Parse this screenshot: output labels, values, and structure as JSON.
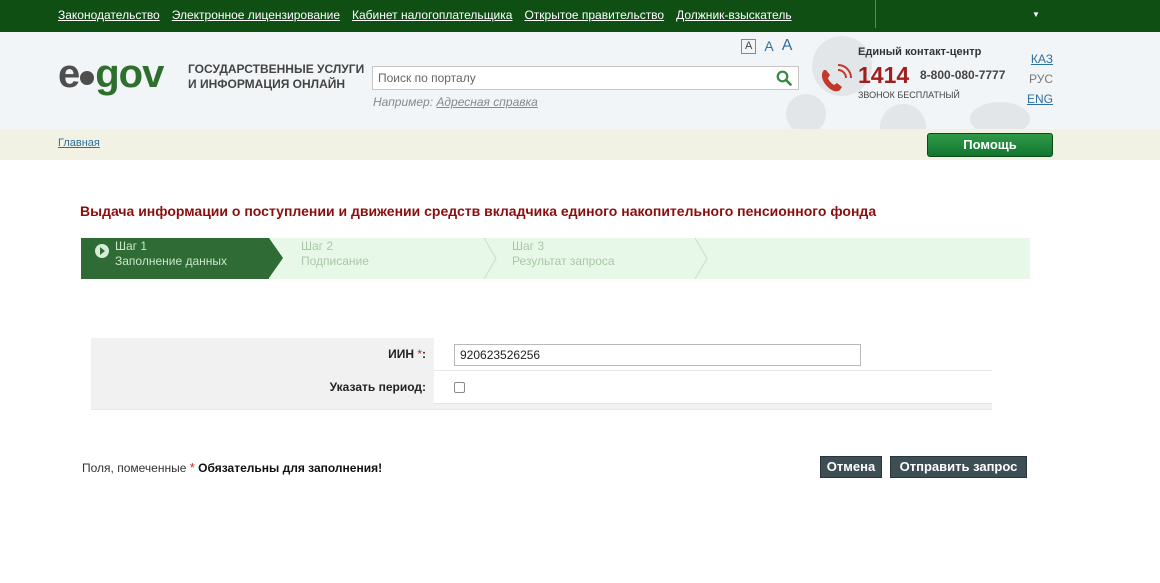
{
  "topnav": {
    "links": [
      "Законодательство",
      "Электронное лицензирование",
      "Кабинет налогоплательщика",
      "Открытое правительство",
      "Должник-взыскатель"
    ]
  },
  "header": {
    "logo": {
      "left": "e",
      "right": "gov"
    },
    "tagline": {
      "line1": "ГОСУДАРСТВЕННЫЕ УСЛУГИ",
      "line2": "И ИНФОРМАЦИЯ ОНЛАЙН"
    },
    "search": {
      "placeholder": "Поиск по порталу"
    },
    "example": {
      "prefix": "Например:",
      "link": "Адресная справка"
    },
    "font_sizes": [
      "A",
      "A",
      "A"
    ],
    "contact": {
      "title": "Единый контакт-центр",
      "short_number": "1414",
      "long_number": "8-800-080-7777",
      "free_label": "ЗВОНОК БЕСПЛАТНЫЙ"
    },
    "languages": {
      "kaz": "КАЗ",
      "rus": "РУС",
      "eng": "ENG"
    }
  },
  "breadcrumb": {
    "home": "Главная"
  },
  "help_button": "Помощь",
  "page_title": "Выдача информации о поступлении и движении средств вкладчика единого накопительного пенсионного фонда",
  "steps": [
    {
      "num": "Шаг 1",
      "name": "Заполнение данных",
      "active": true
    },
    {
      "num": "Шаг 2",
      "name": "Подписание",
      "active": false
    },
    {
      "num": "Шаг 3",
      "name": "Результат запроса",
      "active": false
    }
  ],
  "form": {
    "iin": {
      "label": "ИИН",
      "required_mark": "*",
      "suffix": ":",
      "value": "920623526256"
    },
    "period": {
      "label": "Указать период:",
      "checked": false
    }
  },
  "footer_note": {
    "prefix": "Поля, помеченные",
    "mark": "*",
    "bold": "Обязательны для заполнения!"
  },
  "buttons": {
    "cancel": "Отмена",
    "submit": "Отправить запрос"
  },
  "colors": {
    "topbar": "#0f4f14",
    "title": "#8b0e0e",
    "active_step": "#2f6b35",
    "required": "#d21d1d"
  }
}
